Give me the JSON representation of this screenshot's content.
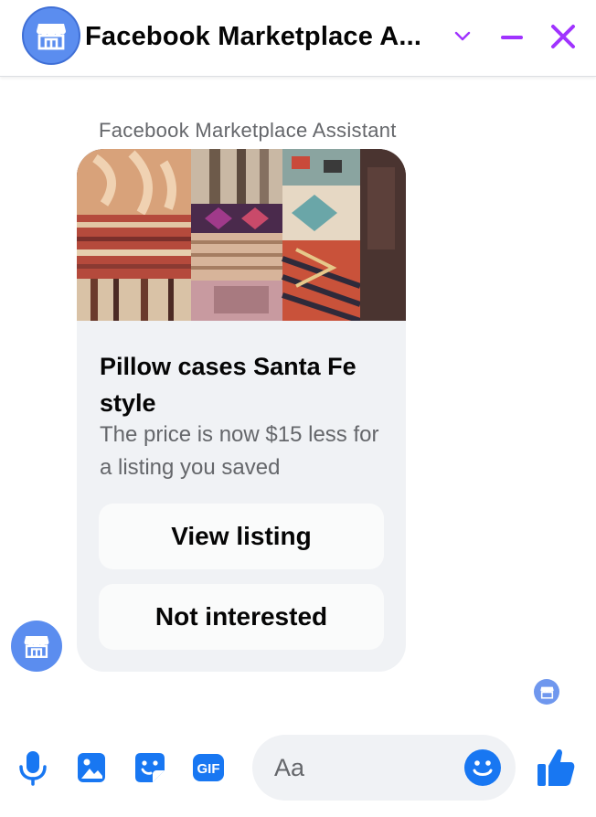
{
  "header": {
    "title": "Facebook Marketplace A...",
    "avatar_icon": "store-icon",
    "dropdown_icon": "chevron-down-icon",
    "minimize_icon": "minimize-icon",
    "close_icon": "close-icon",
    "accent_color": "#a033ff"
  },
  "message": {
    "sender_name": "Facebook Marketplace Assistant",
    "card": {
      "image_alt": "listing-photo",
      "title": "Pillow cases Santa Fe style",
      "subtitle": "The price is now $15 less for a listing you saved",
      "primary_button": "View listing",
      "secondary_button": "Not interested"
    }
  },
  "composer": {
    "icons": [
      "microphone-icon",
      "photo-icon",
      "sticker-icon",
      "gif-icon"
    ],
    "gif_label": "GIF",
    "placeholder": "Aa",
    "emoji_icon": "smiley-icon",
    "like_icon": "thumbs-up-icon",
    "brand_color": "#1877f2"
  }
}
